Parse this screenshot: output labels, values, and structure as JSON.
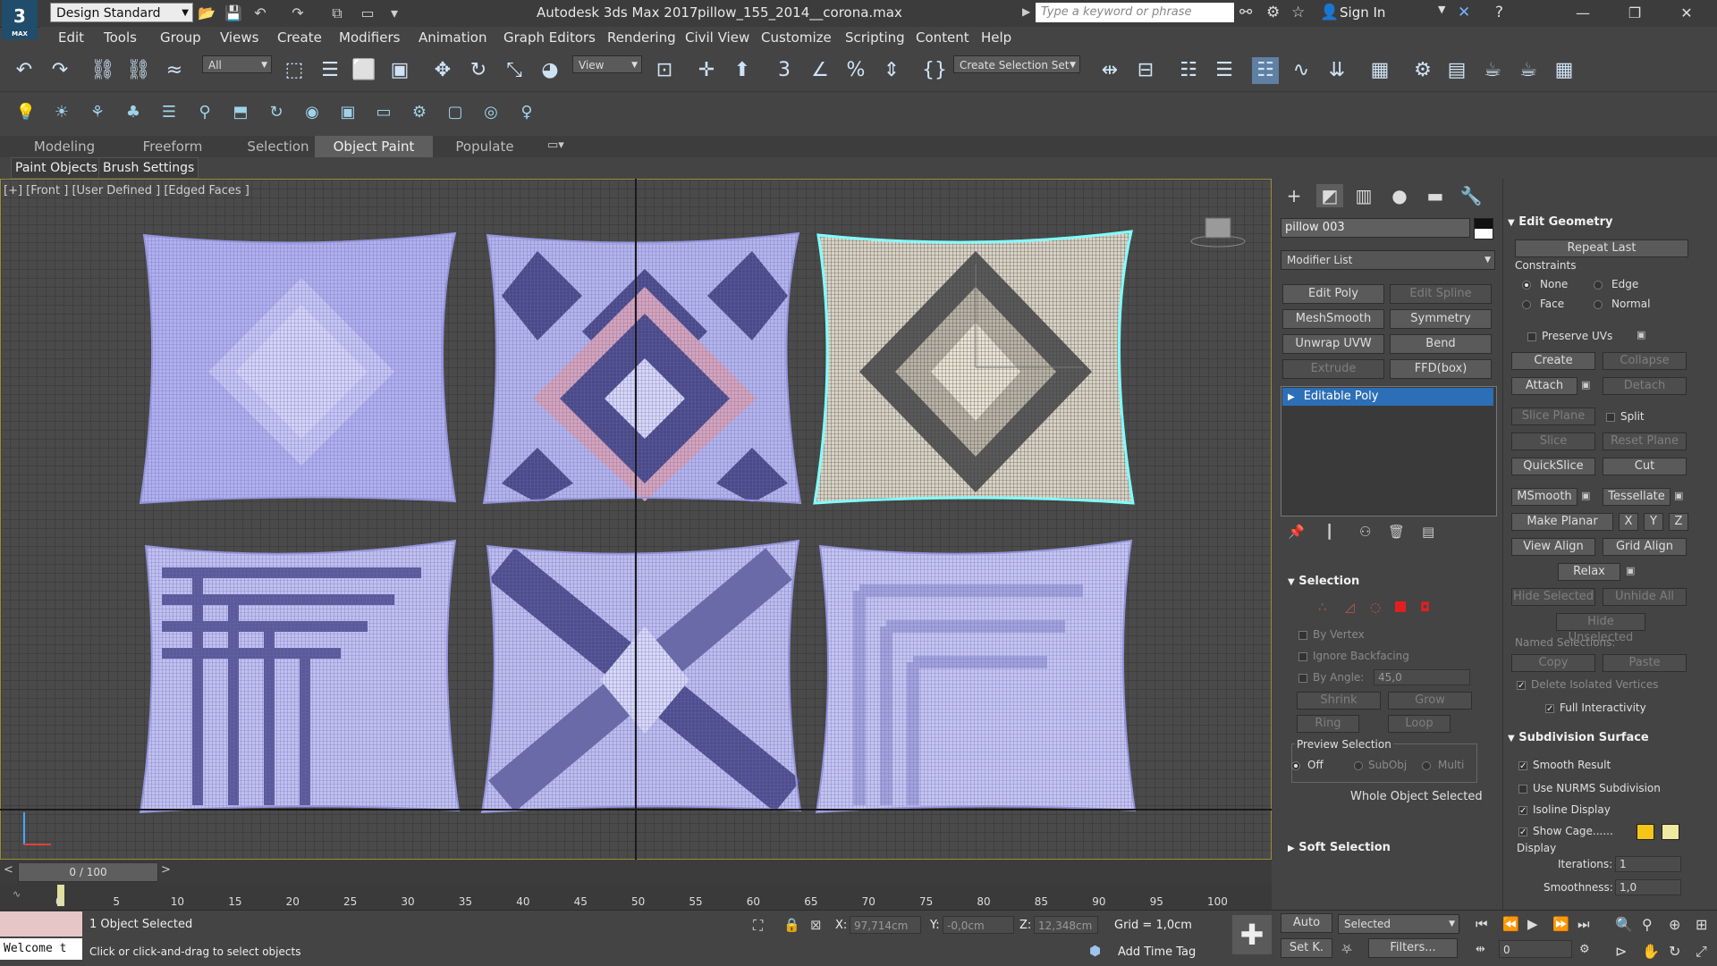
{
  "titlebar": {
    "workspace": "Design Standard",
    "app_title": "Autodesk 3ds Max 2017",
    "file_name": "pillow_155_2014__corona.max",
    "search_placeholder": "Type a keyword or phrase",
    "sign_in": "Sign In",
    "logo_text": "3",
    "logo_sub": "MAX"
  },
  "menu": [
    "Edit",
    "Tools",
    "Group",
    "Views",
    "Create",
    "Modifiers",
    "Animation",
    "Graph Editors",
    "Rendering",
    "Civil View",
    "Customize",
    "Scripting",
    "Content",
    "Help"
  ],
  "toolbar": {
    "selection_filter": "All",
    "ref_coord": "View",
    "named_selection": "Create Selection Set"
  },
  "ribbon": {
    "tabs": [
      "Modeling",
      "Freeform",
      "Selection",
      "Object Paint",
      "Populate"
    ],
    "active_tab": "Object Paint",
    "sub_tabs": [
      "Paint Objects",
      "Brush Settings"
    ]
  },
  "viewport": {
    "label": "[+] [Front ] [User Defined ] [Edged Faces ]"
  },
  "timeline": {
    "slider": "0 / 100",
    "ticks": [
      "0",
      "5",
      "10",
      "15",
      "20",
      "25",
      "30",
      "35",
      "40",
      "45",
      "50",
      "55",
      "60",
      "65",
      "70",
      "75",
      "80",
      "85",
      "90",
      "95",
      "100"
    ]
  },
  "status": {
    "objects_selected": "1 Object Selected",
    "prompt": "Click or click-and-drag to select objects",
    "welcome": "Welcome t",
    "x_label": "X:",
    "x_value": "97,714cm",
    "y_label": "Y:",
    "y_value": "-0,0cm",
    "z_label": "Z:",
    "z_value": "12,348cm",
    "grid": "Grid = 1,0cm",
    "add_time_tag": "Add Time Tag",
    "auto": "Auto",
    "set_key": "Set K.",
    "key_mode": "Selected",
    "filters": "Filters...",
    "frame": "0"
  },
  "command_panel": {
    "object_name": "pillow 003",
    "modifier_list": "Modifier List",
    "modifier_buttons": [
      {
        "label": "Edit Poly",
        "enabled": true
      },
      {
        "label": "Edit Spline",
        "enabled": false
      },
      {
        "label": "MeshSmooth",
        "enabled": true
      },
      {
        "label": "Symmetry",
        "enabled": true
      },
      {
        "label": "Unwrap UVW",
        "enabled": true
      },
      {
        "label": "Bend",
        "enabled": true
      },
      {
        "label": "Extrude",
        "enabled": false
      },
      {
        "label": "FFD(box)",
        "enabled": true
      }
    ],
    "stack": [
      "Editable Poly"
    ],
    "selection": {
      "header": "Selection",
      "by_vertex": "By Vertex",
      "ignore_backfacing": "Ignore Backfacing",
      "by_angle": "By Angle:",
      "by_angle_value": "45,0",
      "shrink": "Shrink",
      "grow": "Grow",
      "ring": "Ring",
      "loop": "Loop",
      "preview_selection": "Preview Selection",
      "preview_off": "Off",
      "preview_subobj": "SubObj",
      "preview_multi": "Multi",
      "status": "Whole Object Selected"
    },
    "soft_selection": "Soft Selection"
  },
  "edit_geometry": {
    "header": "Edit Geometry",
    "repeat_last": "Repeat Last",
    "constraints": "Constraints",
    "none": "None",
    "edge": "Edge",
    "face": "Face",
    "normal": "Normal",
    "preserve_uvs": "Preserve UVs",
    "create": "Create",
    "collapse": "Collapse",
    "attach": "Attach",
    "detach": "Detach",
    "slice_plane": "Slice Plane",
    "split": "Split",
    "slice": "Slice",
    "reset_plane": "Reset Plane",
    "quickslice": "QuickSlice",
    "cut": "Cut",
    "msmooth": "MSmooth",
    "tessellate": "Tessellate",
    "make_planar": "Make Planar",
    "x": "X",
    "y": "Y",
    "z": "Z",
    "view_align": "View Align",
    "grid_align": "Grid Align",
    "relax": "Relax",
    "hide_selected": "Hide Selected",
    "unhide_all": "Unhide All",
    "hide_unselected": "Hide Unselected",
    "named_selections": "Named Selections:",
    "copy": "Copy",
    "paste": "Paste",
    "delete_isolated": "Delete Isolated Vertices",
    "full_interactivity": "Full Interactivity"
  },
  "subdivision": {
    "header": "Subdivision Surface",
    "smooth_result": "Smooth Result",
    "use_nurms": "Use NURMS Subdivision",
    "isoline_display": "Isoline Display",
    "show_cage": "Show Cage......",
    "display": "Display",
    "iterations_label": "Iterations:",
    "iterations": "1",
    "smoothness_label": "Smoothness:",
    "smoothness": "1,0",
    "cage_color1": "#f5c518",
    "cage_color2": "#f0eaa0"
  },
  "colors": {
    "selection_blue": "#2d6fb6",
    "wire_purple": "#a6a6ee",
    "selected_outline": "#7fffff",
    "pattern_red": "#d98a8a"
  }
}
